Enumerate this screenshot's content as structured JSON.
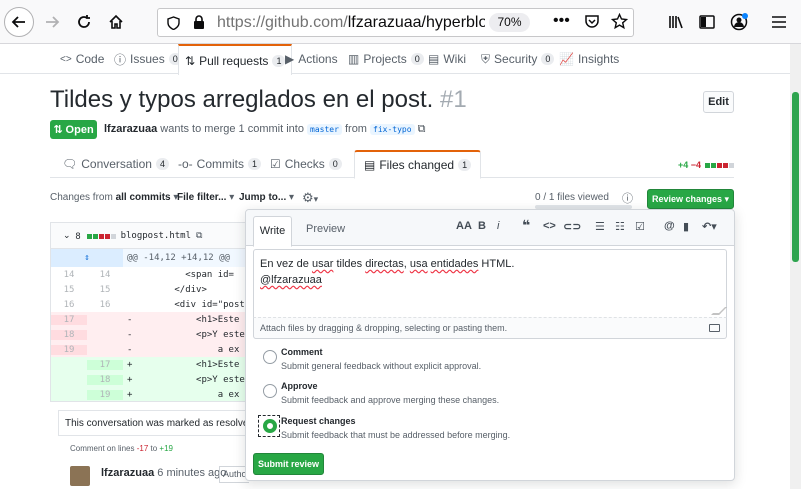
{
  "browser": {
    "url_main": "https://github.com/",
    "url_path": "lfzarazuaa/hyperblo",
    "zoom": "70%"
  },
  "repo_nav": {
    "tabs": [
      {
        "label": "Code",
        "count": ""
      },
      {
        "label": "Issues",
        "count": "0"
      },
      {
        "label": "Pull requests",
        "count": "1"
      },
      {
        "label": "Actions",
        "count": ""
      },
      {
        "label": "Projects",
        "count": "0"
      },
      {
        "label": "Wiki",
        "count": ""
      },
      {
        "label": "Security",
        "count": "0"
      },
      {
        "label": "Insights",
        "count": ""
      }
    ]
  },
  "pr": {
    "title": "Tildes y typos arreglados en el post.",
    "number": "#1",
    "edit_label": "Edit",
    "state": "Open",
    "author": "lfzarazuaa",
    "meta_mid": "wants to merge 1 commit into",
    "base": "master",
    "from_word": "from",
    "head": "fix-typo"
  },
  "pr_tabs": [
    {
      "label": "Conversation",
      "count": "4"
    },
    {
      "label": "Commits",
      "count": "1"
    },
    {
      "label": "Checks",
      "count": "0"
    },
    {
      "label": "Files changed",
      "count": "1"
    }
  ],
  "diffstat": {
    "add": "+4",
    "del": "−4"
  },
  "toolbar": {
    "changes_prefix": "Changes from",
    "changes_value": "all commits",
    "file_filter": "File filter...",
    "jump_to": "Jump to...",
    "files_viewed": "0 / 1 files viewed",
    "review_changes": "Review changes"
  },
  "file": {
    "changes": "8",
    "name": "blogpost.html",
    "hunk": "@@ -14,12 +14,12 @@",
    "lines": [
      {
        "type": "ctx",
        "old": "14",
        "new": "14",
        "sign": " ",
        "code": "         <span id="
      },
      {
        "type": "ctx",
        "old": "15",
        "new": "15",
        "sign": " ",
        "code": "       </div>"
      },
      {
        "type": "ctx",
        "old": "16",
        "new": "16",
        "sign": " ",
        "code": "       <div id=\"post"
      },
      {
        "type": "del",
        "old": "17",
        "new": "",
        "sign": "-",
        "code": "           <h1>Este"
      },
      {
        "type": "del",
        "old": "18",
        "new": "",
        "sign": "-",
        "code": "           <p>Y este"
      },
      {
        "type": "del",
        "old": "19",
        "new": "",
        "sign": "-",
        "code": "               a ex"
      },
      {
        "type": "add",
        "old": "",
        "new": "17",
        "sign": "+",
        "code": "           <h1>Este"
      },
      {
        "type": "add",
        "old": "",
        "new": "18",
        "sign": "+",
        "code": "           <p>Y este"
      },
      {
        "type": "add",
        "old": "",
        "new": "19",
        "sign": "+",
        "code": "               a ex"
      }
    ]
  },
  "conversation": {
    "resolved_text": "This conversation was marked as resolved",
    "comment_on": "Comment on lines",
    "from_line": "-17",
    "to_word": "to",
    "to_line": "+19",
    "author": "lfzarazuaa",
    "time": "6 minutes ago",
    "badge": "Author"
  },
  "review": {
    "tab_write": "Write",
    "tab_preview": "Preview",
    "body_line1_a": "En vez de ",
    "body_line1_b": "usar",
    "body_line1_c": " tildes ",
    "body_line1_d": "directas",
    "body_line1_e": ", ",
    "body_line1_f": "usa",
    "body_line1_g": " ",
    "body_line1_h": "entidades",
    "body_line1_i": " HTML.",
    "body_line2": "@lfzarazuaa",
    "attach_hint": "Attach files by dragging & dropping, selecting or pasting them.",
    "options": [
      {
        "title": "Comment",
        "desc": "Submit general feedback without explicit approval.",
        "checked": false
      },
      {
        "title": "Approve",
        "desc": "Submit feedback and approve merging these changes.",
        "checked": false
      },
      {
        "title": "Request changes",
        "desc": "Submit feedback that must be addressed before merging.",
        "checked": true
      }
    ],
    "submit": "Submit review"
  }
}
